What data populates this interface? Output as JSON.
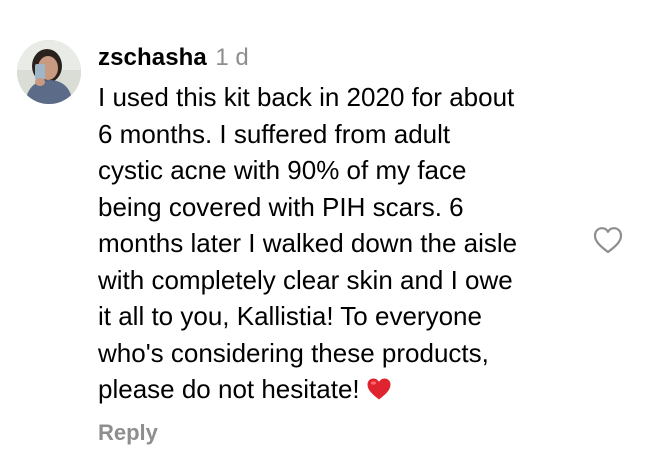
{
  "comment": {
    "username": "zschasha",
    "timestamp": "1 d",
    "lines": [
      "I used this kit back in 2020 for about",
      "6 months. I suffered from adult",
      "cystic acne with 90% of my face",
      "being covered with PIH scars. 6",
      "months later I walked down the aisle",
      "with completely clear skin and I owe",
      "it all to you, Kallistia! To everyone",
      "who's considering these products,",
      "please do not hesitate!"
    ],
    "reply_label": "Reply",
    "icons": {
      "like": "heart-outline-icon",
      "emoji": "red-heart-emoji"
    },
    "colors": {
      "text": "#000000",
      "muted": "#8e8e8e",
      "heart_red": "#e0242f",
      "icon_stroke": "#8e8e8e"
    }
  }
}
